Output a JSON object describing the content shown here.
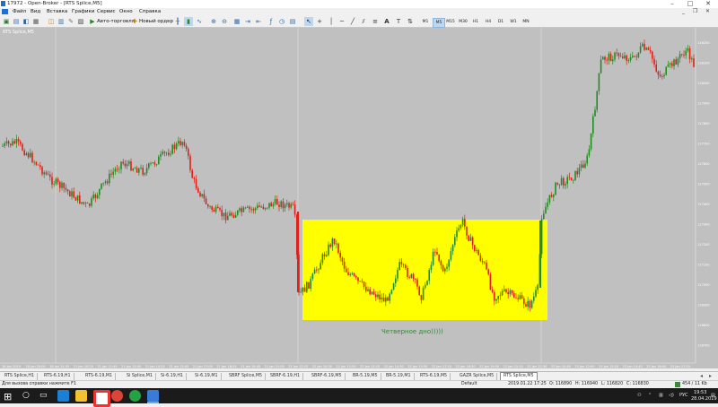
{
  "window": {
    "title": "17972 - Open-Broker - [RTS Splice,M5]"
  },
  "menu": [
    "Файл",
    "Вид",
    "Вставка",
    "Графики",
    "Сервис",
    "Окно",
    "Справка"
  ],
  "toolbar": {
    "autotrade_label": "Авто-торговля",
    "new_order_label": "Новый ордер",
    "timeframes": [
      "M1",
      "M5",
      "M15",
      "M30",
      "H1",
      "H4",
      "D1",
      "W1",
      "MN"
    ],
    "active_timeframe": "M5"
  },
  "chart": {
    "title": "RTS Splice,M5",
    "annotation": "Четверное дно)))))",
    "bull_color": "#228B22",
    "bear_color": "#e0201a",
    "highlight_color": "#ffff00",
    "price_labels": [
      "118200",
      "118100",
      "118000",
      "117900",
      "117800",
      "117700",
      "117600",
      "117500",
      "117400",
      "117300",
      "117200",
      "117100",
      "117000",
      "116900",
      "116800",
      "116700"
    ],
    "time_labels": [
      "18 Jan 2019",
      "18 Jan 20:00",
      "18 Jan 21:35",
      "21 Jan 10:25",
      "21 Jan 11:45",
      "21 Jan 13:05",
      "21 Jan 14:25",
      "21 Jan 15:45",
      "21 Jan 17:05",
      "21 Jan 18:25",
      "21 Jan 19:45",
      "21 Jan 21:05",
      "21 Jan 22:25",
      "22 Jan 10:30",
      "22 Jan 11:50",
      "22 Jan 13:10",
      "22 Jan 14:30",
      "22 Jan 15:50",
      "22 Jan 17:10",
      "22 Jan 18:30",
      "22 Jan 19:50",
      "22 Jan 21:10",
      "22 Jan 22:30",
      "23 Jan 10:40",
      "23 Jan 12:00",
      "23 Jan 13:20",
      "23 Jan 14:40",
      "23 Jan 16:00",
      "23 Jan 17:20"
    ]
  },
  "tabs": [
    "RTS Splice,H1",
    "RTS-6.19,H1",
    "RTS-6.19,M1",
    "Si Splice,M1",
    "Si-6.19,H1",
    "Si-6.19,M1",
    "SBRF Splice,M5",
    "SBRF-6.19,H1",
    "SBRF-6.19,M5",
    "BR-5.19,M5",
    "BR-5.19,M1",
    "RTS-6.19,M5",
    "GAZR Splice,M5",
    "RTS Splice,M5"
  ],
  "active_tab": "RTS Splice,M5",
  "status": {
    "help": "Для вызова справки нажмите F1",
    "profile": "Default",
    "datetime": "2019.01.22 17:25",
    "open": "O: 116890",
    "high": "H: 116940",
    "low": "L: 116820",
    "close": "C: 116830",
    "traffic": "454 / 11 Kb"
  },
  "taskbar": {
    "lang": "РУС",
    "time": "19:53",
    "date": "28.04.2019"
  }
}
